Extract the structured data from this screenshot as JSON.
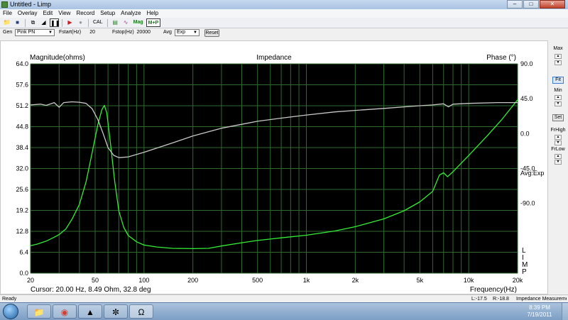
{
  "window": {
    "title": "Untitled - Limp"
  },
  "menu": [
    "File",
    "Overlay",
    "Edit",
    "View",
    "Record",
    "Setup",
    "Analyze",
    "Help"
  ],
  "toolbar": {
    "cal_label": "CAL",
    "mag_label": "Mag",
    "mp_label": "M+P"
  },
  "generator": {
    "gen_label": "Gen",
    "gen_value": "Pink PN",
    "fstart_label": "Fstart(Hz)",
    "fstart_value": "20",
    "fstop_label": "Fstop(Hz)",
    "fstop_value": "20000",
    "avg_label": "Avg",
    "avg_value": "Exp",
    "reset_label": "Reset"
  },
  "side_panel": {
    "max_label": "Max",
    "fit_label": "Fit",
    "min_label": "Min",
    "set_label": "Set",
    "frhigh_label": "FrHigh",
    "frlow_label": "FrLow"
  },
  "chart_data": {
    "type": "line",
    "title": "Impedance",
    "ylabel": "Magnitude(ohms)",
    "y2label": "Phase (°)",
    "xlabel": "Frequency(Hz)",
    "x_scale": "log",
    "xlim": [
      20,
      20000
    ],
    "ylim": [
      0,
      64
    ],
    "y2lim": [
      -180,
      90
    ],
    "yticks": [
      "0.0",
      "6.4",
      "12.8",
      "19.2",
      "25.6",
      "32.0",
      "38.4",
      "44.8",
      "51.2",
      "57.6",
      "64.0"
    ],
    "y2ticks": [
      "90.0",
      "45.0",
      "0.0",
      "-45.0",
      "-90.0"
    ],
    "xticks": [
      {
        "v": 20,
        "t": "20"
      },
      {
        "v": 50,
        "t": "50"
      },
      {
        "v": 100,
        "t": "100"
      },
      {
        "v": 200,
        "t": "200"
      },
      {
        "v": 500,
        "t": "500"
      },
      {
        "v": 1000,
        "t": "1k"
      },
      {
        "v": 2000,
        "t": "2k"
      },
      {
        "v": 5000,
        "t": "5k"
      },
      {
        "v": 10000,
        "t": "10k"
      },
      {
        "v": 20000,
        "t": "20k"
      }
    ],
    "grid": true,
    "background": "#000000",
    "grid_color": "#2f6a2f",
    "avg_annotation": "Avg:Exp",
    "limp_annotation": "LIMP",
    "cursor_text": "Cursor: 20.00 Hz, 8.49 Ohm, 32.8 deg",
    "series": [
      {
        "name": "Magnitude",
        "color": "#33ee33",
        "axis": "left",
        "points": [
          [
            20,
            8.4
          ],
          [
            22,
            8.9
          ],
          [
            25,
            9.8
          ],
          [
            28,
            11.0
          ],
          [
            30,
            11.8
          ],
          [
            33,
            13.5
          ],
          [
            36,
            16.5
          ],
          [
            40,
            21.0
          ],
          [
            44,
            28.0
          ],
          [
            48,
            37.0
          ],
          [
            52,
            45.5
          ],
          [
            55,
            50.0
          ],
          [
            57,
            51.3
          ],
          [
            59,
            49.0
          ],
          [
            62,
            40.0
          ],
          [
            66,
            28.0
          ],
          [
            70,
            19.0
          ],
          [
            75,
            14.0
          ],
          [
            80,
            11.5
          ],
          [
            90,
            9.6
          ],
          [
            100,
            8.6
          ],
          [
            120,
            8.0
          ],
          [
            150,
            7.6
          ],
          [
            200,
            7.5
          ],
          [
            250,
            7.6
          ],
          [
            300,
            8.3
          ],
          [
            400,
            9.3
          ],
          [
            500,
            10.0
          ],
          [
            700,
            10.8
          ],
          [
            1000,
            11.6
          ],
          [
            1500,
            12.9
          ],
          [
            2000,
            14.2
          ],
          [
            3000,
            16.6
          ],
          [
            4000,
            19.1
          ],
          [
            5000,
            21.8
          ],
          [
            6000,
            25.0
          ],
          [
            6600,
            30.0
          ],
          [
            7000,
            30.7
          ],
          [
            7400,
            29.5
          ],
          [
            8000,
            31.0
          ],
          [
            10000,
            36.0
          ],
          [
            13000,
            42.0
          ],
          [
            16000,
            47.0
          ],
          [
            20000,
            53.0
          ]
        ]
      },
      {
        "name": "Phase",
        "color": "#c8c8c8",
        "axis": "right",
        "points": [
          [
            20,
            37.0
          ],
          [
            23,
            38.0
          ],
          [
            25,
            36.5
          ],
          [
            28,
            40.0
          ],
          [
            30,
            34.0
          ],
          [
            32,
            40.0
          ],
          [
            36,
            41.0
          ],
          [
            40,
            40.5
          ],
          [
            44,
            39.0
          ],
          [
            48,
            32.0
          ],
          [
            52,
            18.0
          ],
          [
            56,
            0.0
          ],
          [
            60,
            -18.0
          ],
          [
            65,
            -28.0
          ],
          [
            70,
            -31.0
          ],
          [
            80,
            -30.0
          ],
          [
            100,
            -24.0
          ],
          [
            150,
            -12.0
          ],
          [
            200,
            -3.0
          ],
          [
            300,
            7.0
          ],
          [
            400,
            12.0
          ],
          [
            500,
            16.0
          ],
          [
            700,
            20.0
          ],
          [
            1000,
            24.0
          ],
          [
            1500,
            28.0
          ],
          [
            2000,
            30.0
          ],
          [
            3000,
            32.5
          ],
          [
            4000,
            34.5
          ],
          [
            5000,
            36.0
          ],
          [
            6000,
            37.0
          ],
          [
            7000,
            38.5
          ],
          [
            7500,
            34.5
          ],
          [
            8000,
            38.0
          ],
          [
            10000,
            39.0
          ],
          [
            15000,
            40.0
          ],
          [
            20000,
            40.0
          ]
        ]
      }
    ]
  },
  "status": {
    "left": "Ready",
    "lr": "L:-17.5",
    "rr": "R:-18.8",
    "right": "Impedance Measuremen"
  },
  "taskbar": {
    "time": "8:39 PM",
    "date": "7/19/2011"
  }
}
